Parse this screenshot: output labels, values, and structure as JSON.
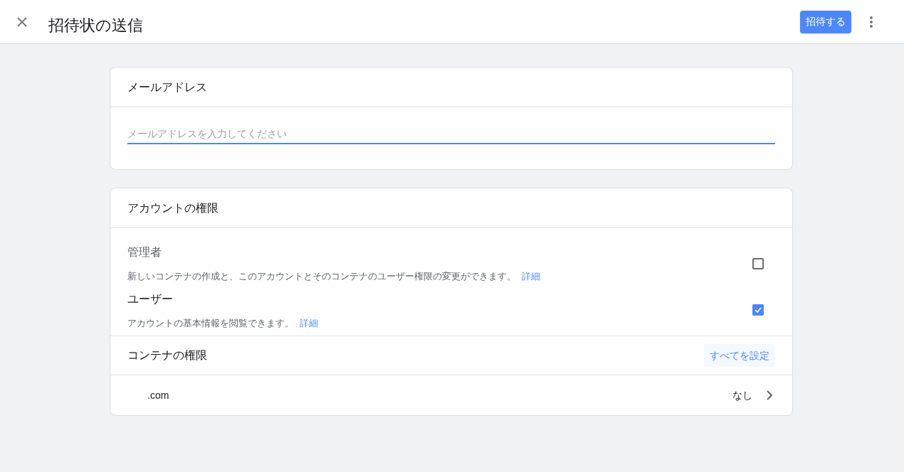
{
  "header": {
    "title": "招待状の送信",
    "invite_button": "招待する"
  },
  "email_section": {
    "title": "メールアドレス",
    "placeholder": "メールアドレスを入力してください"
  },
  "account_section": {
    "title": "アカウントの権限",
    "roles": [
      {
        "name": "管理者",
        "description": "新しいコンテナの作成と、このアカウントとそのコンテナのユーザー権限の変更ができます。",
        "link": "詳細",
        "checked": false
      },
      {
        "name": "ユーザー",
        "description": "アカウントの基本情報を閲覧できます。",
        "link": "詳細",
        "checked": true
      }
    ]
  },
  "container_section": {
    "title": "コンテナの権限",
    "set_all_button": "すべてを設定",
    "containers": [
      {
        "name": ".com",
        "permission": "なし"
      }
    ]
  }
}
